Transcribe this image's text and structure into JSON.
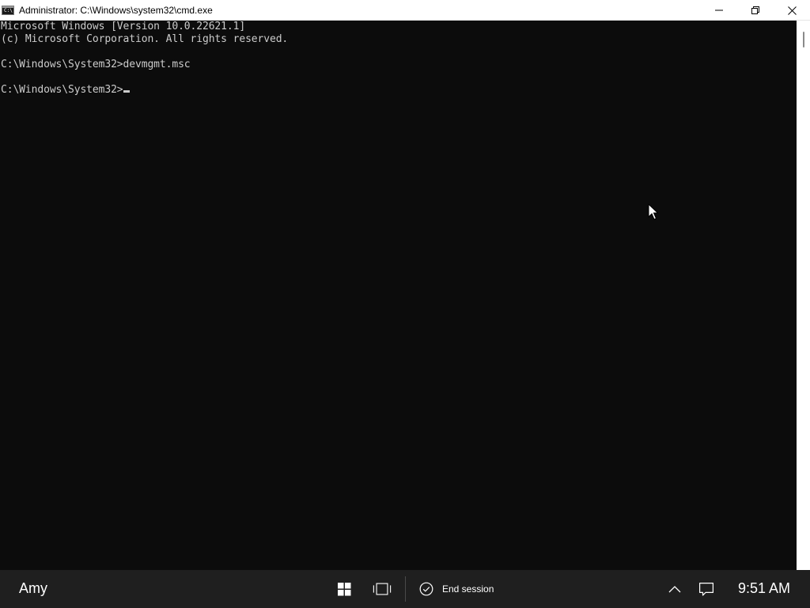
{
  "window": {
    "icon_glyph": "C:\\",
    "title": "Administrator: C:\\Windows\\system32\\cmd.exe",
    "controls": [
      "minimize-icon",
      "restore-icon",
      "close-icon"
    ]
  },
  "console": {
    "lines": [
      "Microsoft Windows [Version 10.0.22621.1]",
      "(c) Microsoft Corporation. All rights reserved.",
      "",
      "C:\\Windows\\System32>devmgmt.msc",
      "",
      "C:\\Windows\\System32>"
    ],
    "text_color": "#cccccc",
    "background": "#0c0c0c"
  },
  "taskbar": {
    "user": "Amy",
    "icons": [
      "windows-start-icon",
      "task-view-icon",
      "chevron-up-icon",
      "notification-icon"
    ],
    "end_session_label": "End session",
    "clock": "9:51 AM",
    "background": "#1f1f1f"
  }
}
